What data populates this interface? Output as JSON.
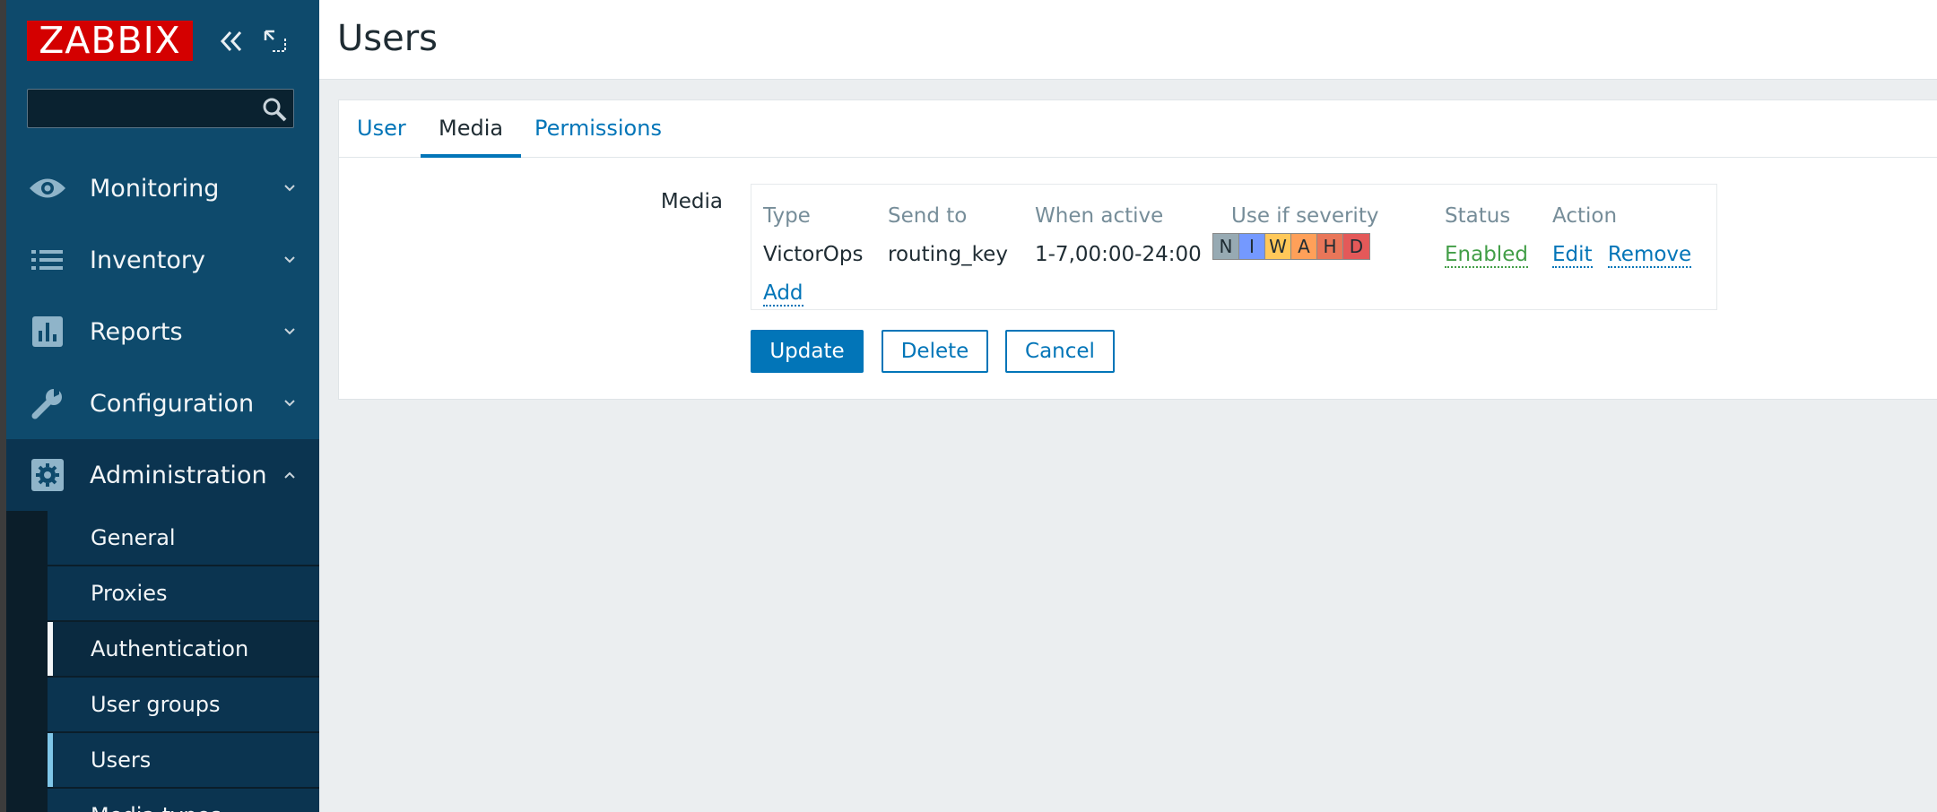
{
  "sidebar": {
    "logo": "ZABBIX",
    "search": {
      "value": "",
      "placeholder": ""
    },
    "menu": [
      {
        "label": "Monitoring",
        "icon": "eye-icon"
      },
      {
        "label": "Inventory",
        "icon": "list-icon"
      },
      {
        "label": "Reports",
        "icon": "bar-chart-icon"
      },
      {
        "label": "Configuration",
        "icon": "wrench-icon"
      },
      {
        "label": "Administration",
        "icon": "gear-icon",
        "expanded": true
      }
    ],
    "submenu": [
      {
        "label": "General"
      },
      {
        "label": "Proxies"
      },
      {
        "label": "Authentication",
        "state": "hovered"
      },
      {
        "label": "User groups"
      },
      {
        "label": "Users",
        "state": "selected"
      },
      {
        "label": "Media types"
      }
    ]
  },
  "page": {
    "title": "Users"
  },
  "tabs": [
    {
      "label": "User"
    },
    {
      "label": "Media",
      "active": true
    },
    {
      "label": "Permissions"
    }
  ],
  "media": {
    "field_label": "Media",
    "headers": {
      "type": "Type",
      "send_to": "Send to",
      "when_active": "When active",
      "severity": "Use if severity",
      "status": "Status",
      "action": "Action"
    },
    "rows": [
      {
        "type": "VictorOps",
        "send_to": "routing_key",
        "when_active": "1-7,00:00-24:00",
        "severity": [
          {
            "letter": "N",
            "color": "#97aab3"
          },
          {
            "letter": "I",
            "color": "#7499ff"
          },
          {
            "letter": "W",
            "color": "#ffc859"
          },
          {
            "letter": "A",
            "color": "#ffa059"
          },
          {
            "letter": "H",
            "color": "#e97659"
          },
          {
            "letter": "D",
            "color": "#e45959"
          }
        ],
        "status": "Enabled",
        "edit_label": "Edit",
        "remove_label": "Remove"
      }
    ],
    "add_label": "Add"
  },
  "buttons": {
    "update": "Update",
    "delete": "Delete",
    "cancel": "Cancel"
  },
  "colors": {
    "sidebar_bg": "#0e4a6c",
    "brand_red": "#d40000",
    "link_blue": "#0275b8",
    "enabled_green": "#429e47"
  }
}
